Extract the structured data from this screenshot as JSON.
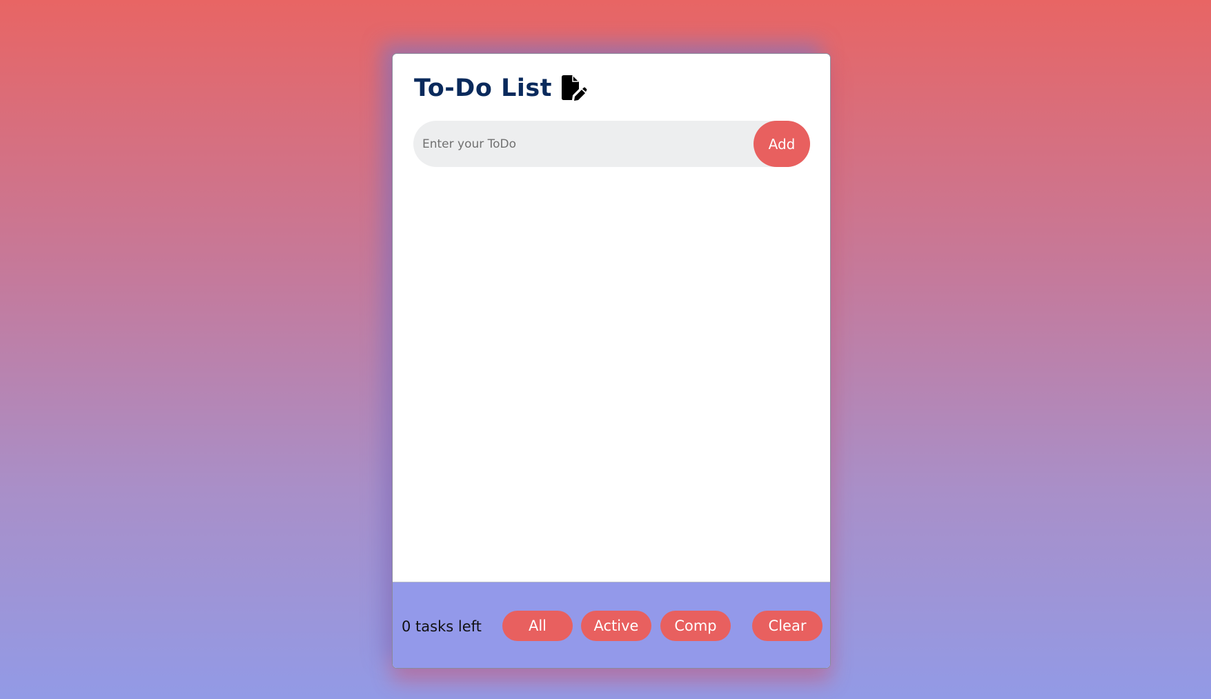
{
  "app": {
    "title": "To-Do List",
    "title_icon": "file-pen-icon"
  },
  "input": {
    "placeholder": "Enter your ToDo",
    "value": ""
  },
  "add_button": {
    "label": "Add"
  },
  "todos": [],
  "footer": {
    "tasks_left": "0 tasks left",
    "filters": {
      "all": "All",
      "active": "Active",
      "comp": "Comp"
    },
    "clear_label": "Clear"
  },
  "colors": {
    "accent": "#e8605f",
    "title": "#0a2a5c",
    "footer_bg": "#9399ea",
    "input_bg": "#edeeef"
  }
}
